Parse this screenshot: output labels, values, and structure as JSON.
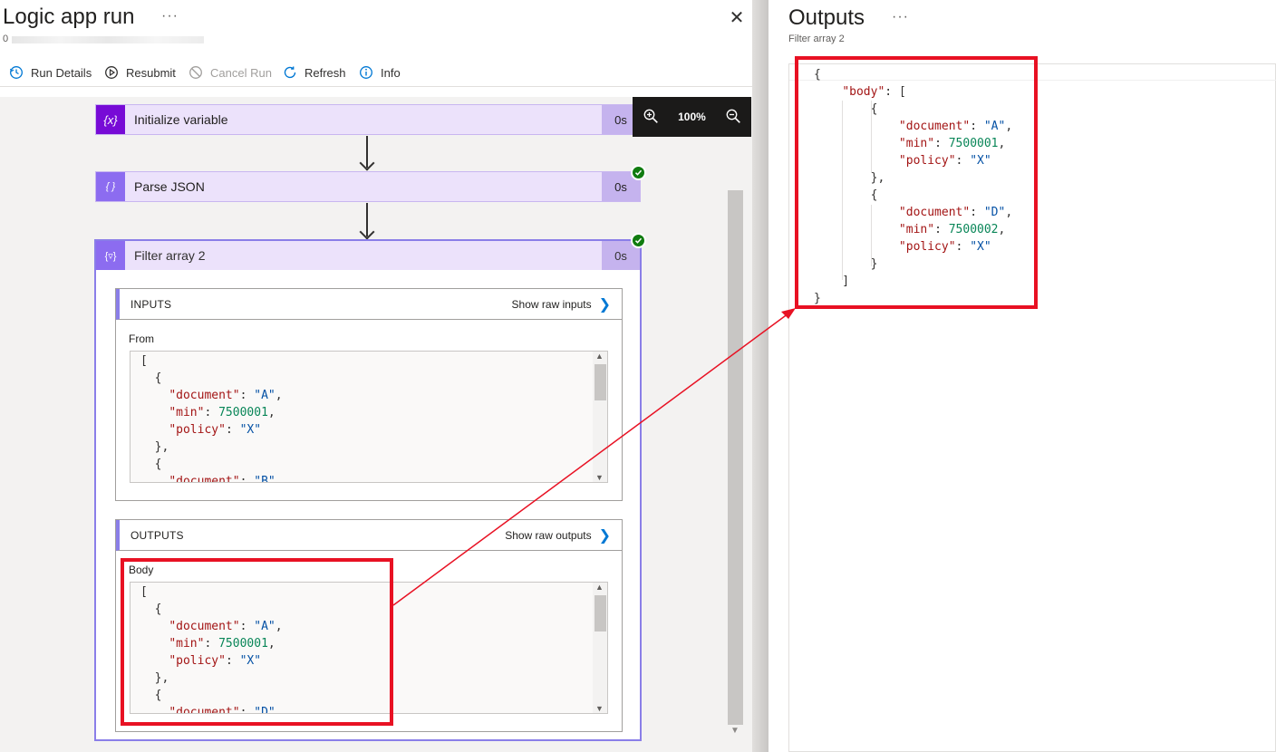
{
  "left_blade": {
    "title": "Logic app run",
    "more": "···",
    "subtitle_prefix": "0",
    "close": "✕"
  },
  "toolbar": {
    "run_details": "Run Details",
    "resubmit": "Resubmit",
    "cancel_run": "Cancel Run",
    "refresh": "Refresh",
    "info": "Info"
  },
  "zoom": {
    "level": "100%"
  },
  "steps": [
    {
      "label": "Initialize variable",
      "duration": "0s",
      "icon": "variable-icon"
    },
    {
      "label": "Parse JSON",
      "duration": "0s",
      "icon": "parse-json-icon"
    },
    {
      "label": "Filter array 2",
      "duration": "0s",
      "icon": "filter-array-icon"
    }
  ],
  "inputs": {
    "title": "INPUTS",
    "link": "Show raw inputs",
    "field_label": "From",
    "code_lines": [
      [
        "[",
        ""
      ],
      [
        "  {",
        ""
      ],
      [
        "    ",
        "\"document\"",
        ": ",
        "\"A\"",
        ","
      ],
      [
        "    ",
        "\"min\"",
        ": ",
        "7500001",
        ","
      ],
      [
        "    ",
        "\"policy\"",
        ": ",
        "\"X\"",
        ""
      ],
      [
        "  },",
        ""
      ],
      [
        "  {",
        ""
      ],
      [
        "    ",
        "\"document\"",
        ": ",
        "\"B\"",
        ","
      ]
    ]
  },
  "outputs": {
    "title": "OUTPUTS",
    "link": "Show raw outputs",
    "field_label": "Body",
    "code_lines": [
      [
        "[",
        ""
      ],
      [
        "  {",
        ""
      ],
      [
        "    ",
        "\"document\"",
        ": ",
        "\"A\"",
        ","
      ],
      [
        "    ",
        "\"min\"",
        ": ",
        "7500001",
        ","
      ],
      [
        "    ",
        "\"policy\"",
        ": ",
        "\"X\"",
        ""
      ],
      [
        "  },",
        ""
      ],
      [
        "  {",
        ""
      ],
      [
        "    ",
        "\"document\"",
        ": ",
        "\"D\"",
        ","
      ]
    ]
  },
  "right_blade": {
    "title": "Outputs",
    "more": "···",
    "subtitle": "Filter array 2",
    "code_lines": [
      [
        "{",
        ""
      ],
      [
        "    ",
        "\"body\"",
        ": ",
        "[",
        ""
      ],
      [
        "        {",
        ""
      ],
      [
        "            ",
        "\"document\"",
        ": ",
        "\"A\"",
        ","
      ],
      [
        "            ",
        "\"min\"",
        ": ",
        "7500001",
        ","
      ],
      [
        "            ",
        "\"policy\"",
        ": ",
        "\"X\"",
        ""
      ],
      [
        "        },",
        ""
      ],
      [
        "        {",
        ""
      ],
      [
        "            ",
        "\"document\"",
        ": ",
        "\"D\"",
        ","
      ],
      [
        "            ",
        "\"min\"",
        ": ",
        "7500002",
        ","
      ],
      [
        "            ",
        "\"policy\"",
        ": ",
        "\"X\"",
        ""
      ],
      [
        "        }",
        ""
      ],
      [
        "    ]",
        ""
      ],
      [
        "}",
        ""
      ]
    ]
  },
  "colors": {
    "accent_purple": "#8a7ee8",
    "step_bg": "#ece2fb",
    "success_green": "#107c10",
    "annotation_red": "#e81123",
    "link_blue": "#0078d4"
  }
}
